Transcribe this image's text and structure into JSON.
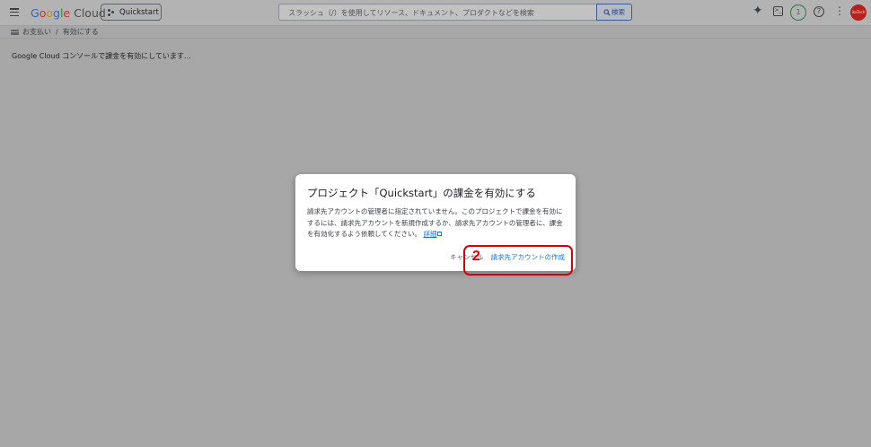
{
  "header": {
    "logo": {
      "g1": "G",
      "o1": "o",
      "o2": "o",
      "g2": "g",
      "l": "l",
      "e": "e",
      "cloud": "Cloud"
    },
    "project_label": "Quickstart",
    "search_placeholder": "スラッシュ（/）を使用してリソース、ドキュメント、プロダクトなどを検索",
    "search_button_label": "検索",
    "notification_count": "1",
    "help_label": "?",
    "more_label": "⋮",
    "gemini_glyph": "✦",
    "terminal_glyph": ">_",
    "avatar_text": "ikaTech"
  },
  "breadcrumb": {
    "parent": "お支払い",
    "separator": "/",
    "current": "有効にする"
  },
  "status_text": "Google Cloud コンソールで課金を有効にしています…",
  "dialog": {
    "title": "プロジェクト「Quickstart」の課金を有効にする",
    "body": "請求先アカウントの管理者に指定されていません。このプロジェクトで課金を有効にするには、請求先アカウントを新規作成するか、請求先アカウントの管理者に、課金を有効化するよう依頼してください。",
    "detail_link": "詳細",
    "cancel_label": "キャンセル",
    "create_label": "請求先アカウントの作成"
  },
  "annotation": {
    "step_number": "2"
  },
  "colors": {
    "overlay_background": "#a7a7a7",
    "link_blue": "#1a73e8",
    "highlight_red": "#d8000a",
    "notification_green": "#2b7a3d"
  },
  "icons": [
    "menu-icon",
    "project-icon",
    "search-icon",
    "gemini-icon",
    "terminal-icon",
    "help-icon",
    "more-icon",
    "billing-icon",
    "external-link-icon"
  ]
}
